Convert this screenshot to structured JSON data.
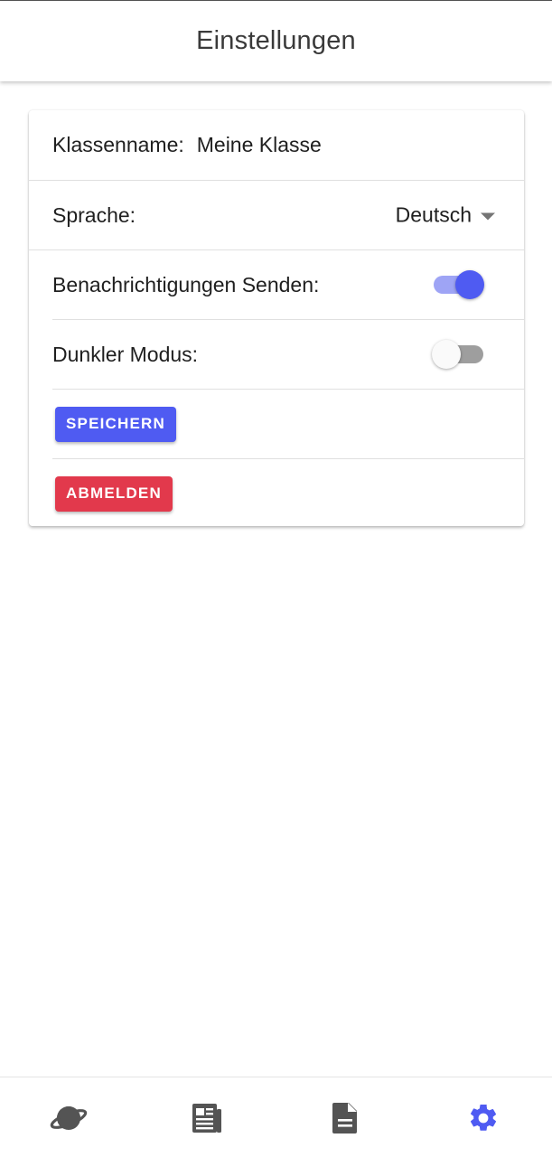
{
  "app": {
    "title": "Einstellungen"
  },
  "settings": {
    "class_name_label": "Klassenname:",
    "class_name_value": "Meine Klasse",
    "language_label": "Sprache:",
    "language_value": "Deutsch",
    "notifications_label": "Benachrichtigungen Senden:",
    "notifications_enabled": true,
    "dark_mode_label": "Dunkler Modus:",
    "dark_mode_enabled": false
  },
  "buttons": {
    "save_label": "SPEICHERN",
    "logout_label": "ABMELDEN"
  },
  "bottom_nav": {
    "items": [
      {
        "icon": "planet-icon",
        "active": false
      },
      {
        "icon": "newspaper-icon",
        "active": false
      },
      {
        "icon": "document-icon",
        "active": false
      },
      {
        "icon": "gear-icon",
        "active": true
      }
    ]
  },
  "colors": {
    "accent": "#4f5bf2",
    "accent_light": "#9ea4f5",
    "danger": "#e2394c",
    "icon_inactive": "#545454",
    "switch_off_track": "#9e9e9e"
  }
}
